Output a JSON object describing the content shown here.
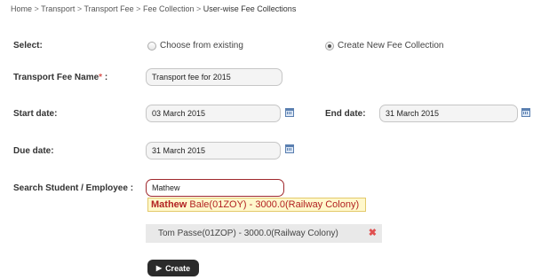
{
  "breadcrumb": {
    "items": [
      "Home",
      "Transport",
      "Transport Fee",
      "Fee Collection"
    ],
    "current": "User-wise Fee Collections",
    "separator": ">"
  },
  "form": {
    "select_label": "Select:",
    "radio_existing": "Choose from existing",
    "radio_new": "Create New Fee Collection",
    "selected_option": "Create New Fee Collection",
    "fee_name_label": "Transport Fee Name",
    "required_mark": "*",
    "label_colon": ":",
    "fee_name_value": "Transport fee for 2015",
    "start_date_label": "Start date:",
    "start_date_value": "03 March 2015",
    "end_date_label": "End date:",
    "end_date_value": "31 March 2015",
    "due_date_label": "Due date:",
    "due_date_value": "31 March 2015",
    "search_label": "Search Student / Employee :",
    "search_value": "Mathew"
  },
  "autocomplete": {
    "match": "Mathew",
    "rest": " Bale(01ZOY) - 3000.0(Railway Colony)"
  },
  "selected_list": [
    {
      "label": "Tom Passe(01ZOP) - 3000.0(Railway Colony)",
      "remove_icon": "close-x-icon"
    }
  ],
  "actions": {
    "create_label": "Create",
    "create_icon": "play-triangle-icon"
  },
  "colors": {
    "accent_red": "#b22222",
    "button_bg": "#2b2b2b",
    "highlight_bg": "#fff8cc"
  }
}
